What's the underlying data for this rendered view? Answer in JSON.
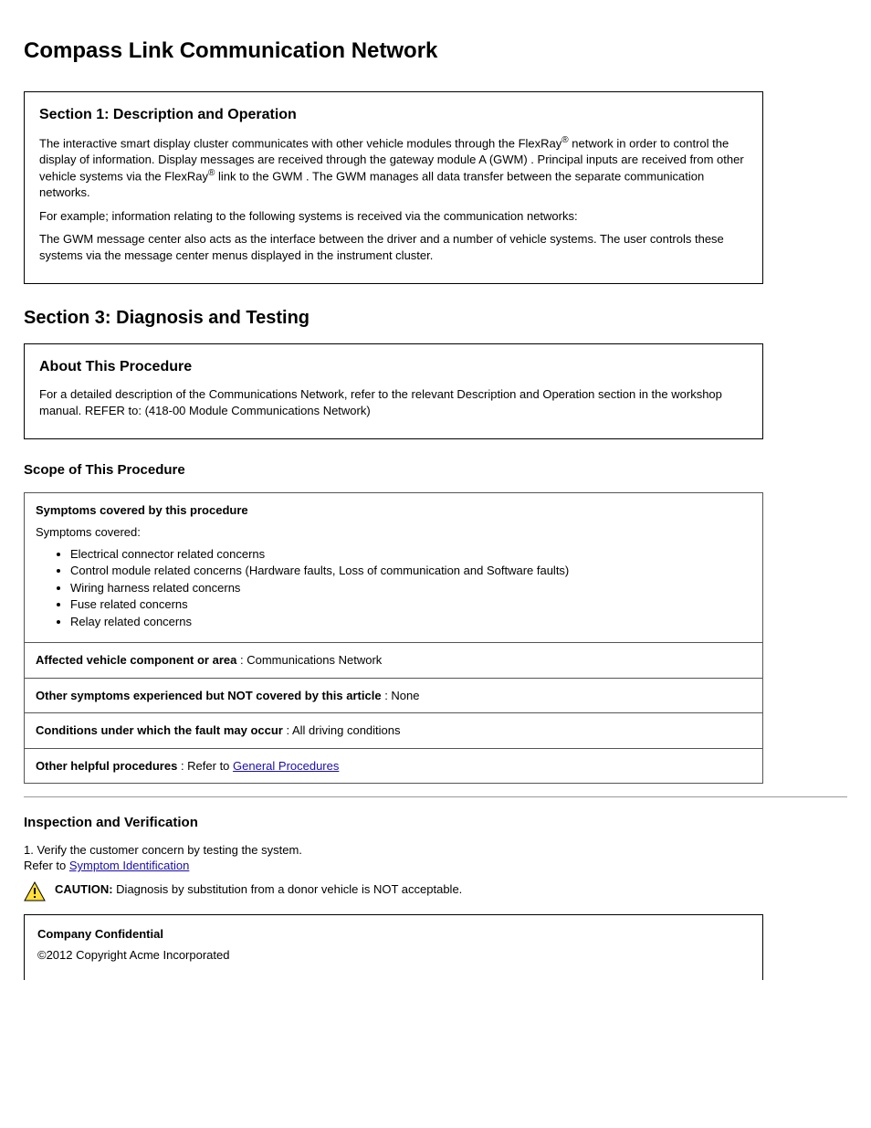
{
  "title": "Compass Link Communication Network",
  "lead": {
    "heading": "Section 1: Description and Operation",
    "p1_a": "The interactive smart display cluster communicates with other vehicle modules through the ",
    "p1_b": "FlexRay",
    "p1_c": " network in order to control the display of information. Display messages are received through the gateway module A (GWM) . Principal inputs are received from other vehicle systems via the ",
    "p1_d": "FlexRay",
    "p1_e": " link to the GWM . The GWM manages all data transfer between the separate communication networks.",
    "p2": "For example; information relating to the following systems is received via the communication networks:",
    "p3": "The GWM message center also acts as the interface between the driver and a number of vehicle systems. The user controls these systems via the message center menus displayed in the instrument cluster."
  },
  "diag_heading": "Section 3: Diagnosis and Testing",
  "about": {
    "heading": "About This Procedure",
    "text": "For a detailed description of the Communications Network, refer to the relevant Description and Operation section in the workshop manual. REFER to: (418-00 Module Communications Network)"
  },
  "scope_heading": "Scope of This Procedure",
  "scope": {
    "symptoms_label": "Symptoms covered by this procedure",
    "symptoms_intro": "Symptoms covered:",
    "symptoms": [
      "Electrical connector related concerns",
      "Control module related concerns (Hardware faults, Loss of communication and Software faults)",
      "Wiring harness related concerns",
      "Fuse related concerns",
      "Relay related concerns"
    ],
    "affected_label": "Affected vehicle component or area",
    "affected_value": "Communications Network",
    "other_symptoms_label": "Other symptoms experienced but NOT covered by this article",
    "other_symptoms_value": "None",
    "conditions_label": "Conditions under which the fault may occur",
    "conditions_value": "All driving conditions",
    "procedures_label": "Other helpful procedures",
    "procedures_prefix": "Refer to ",
    "procedures_link": "General Procedures"
  },
  "inspection": {
    "heading": "Inspection and Verification",
    "step_prefix": "1. Verify the customer concern by testing the system. ",
    "step_refer": "Refer to ",
    "step_link": "Symptom Identification"
  },
  "caution": {
    "label": "CAUTION:",
    "text": "Diagnosis by substitution from a donor vehicle is NOT acceptable."
  },
  "footer": {
    "confidential": "Company Confidential",
    "copyright": "©2012 Copyright Acme Incorporated"
  }
}
